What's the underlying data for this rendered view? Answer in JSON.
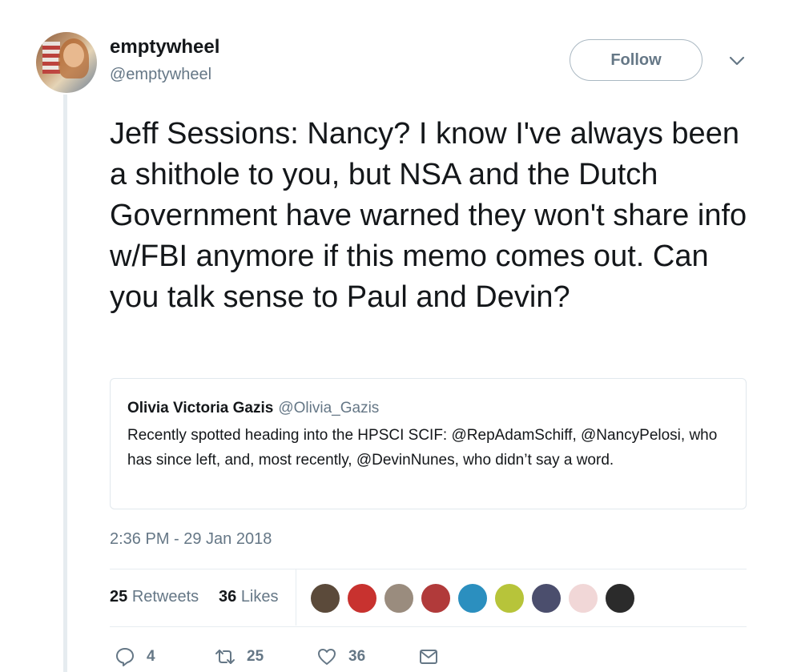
{
  "author": {
    "display_name": "emptywheel",
    "handle": "@emptywheel",
    "avatar_icon": "profile-photo"
  },
  "follow_label": "Follow",
  "tweet_text": "Jeff Sessions: Nancy? I know I've always been a shithole to you, but NSA and the Dutch Government have warned they won't share info w/FBI anymore if this memo comes out. Can you talk sense to Paul and Devin?",
  "quoted_tweet": {
    "name": "Olivia Victoria Gazis",
    "handle": "@Olivia_Gazis",
    "text": "Recently spotted heading into the HPSCI SCIF: @RepAdamSchiff, @NancyPelosi, who has since left, and, most recently, @DevinNunes, who didn’t say a word."
  },
  "timestamp": "2:36 PM - 29 Jan 2018",
  "stats": {
    "retweets_count": "25",
    "retweets_label": "Retweets",
    "likes_count": "36",
    "likes_label": "Likes"
  },
  "likers": [
    {
      "color": "#5b4a3a"
    },
    {
      "color": "#c8322f"
    },
    {
      "color": "#9a8c7e"
    },
    {
      "color": "#b13a3a"
    },
    {
      "color": "#2b8fbf"
    },
    {
      "color": "#b7c43a"
    },
    {
      "color": "#4b4e6d"
    },
    {
      "color": "#f1d7d7"
    },
    {
      "color": "#2b2b2b"
    }
  ],
  "actions": {
    "reply_count": "4",
    "retweet_count": "25",
    "like_count": "36"
  },
  "colors": {
    "text": "#14171a",
    "muted": "#657786",
    "border": "#e1e8ed"
  }
}
